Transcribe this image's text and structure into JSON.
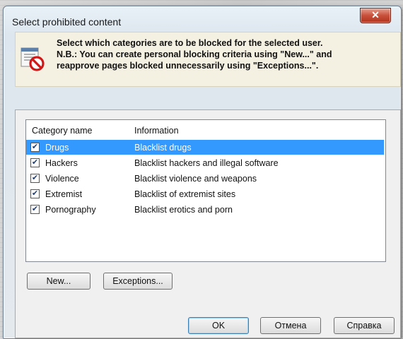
{
  "window": {
    "title": "Select prohibited content",
    "close_symbol": "✕"
  },
  "banner": {
    "icon": "blocked-content-icon",
    "line1": "Select which categories are to be blocked for the selected user.",
    "line2": "N.B.: You can create personal blocking criteria using \"New...\" and",
    "line3": "reapprove pages blocked unnecessarily using \"Exceptions...\"."
  },
  "list": {
    "columns": [
      "Category name",
      "Information"
    ],
    "rows": [
      {
        "name": "Drugs",
        "info": "Blacklist drugs",
        "checked": true,
        "selected": true
      },
      {
        "name": "Hackers",
        "info": "Blacklist hackers and illegal software",
        "checked": true,
        "selected": false
      },
      {
        "name": "Violence",
        "info": "Blacklist violence and weapons",
        "checked": true,
        "selected": false
      },
      {
        "name": "Extremist",
        "info": "Blacklist of extremist sites",
        "checked": true,
        "selected": false
      },
      {
        "name": "Pornography",
        "info": "Blacklist erotics and porn",
        "checked": true,
        "selected": false
      }
    ]
  },
  "buttons": {
    "new": "New...",
    "exceptions": "Exceptions...",
    "ok": "OK",
    "cancel": "Отмена",
    "help": "Справка"
  },
  "colors": {
    "selection": "#3399ff",
    "banner_bg": "#f5f1e2",
    "close_button": "#c8503a"
  }
}
